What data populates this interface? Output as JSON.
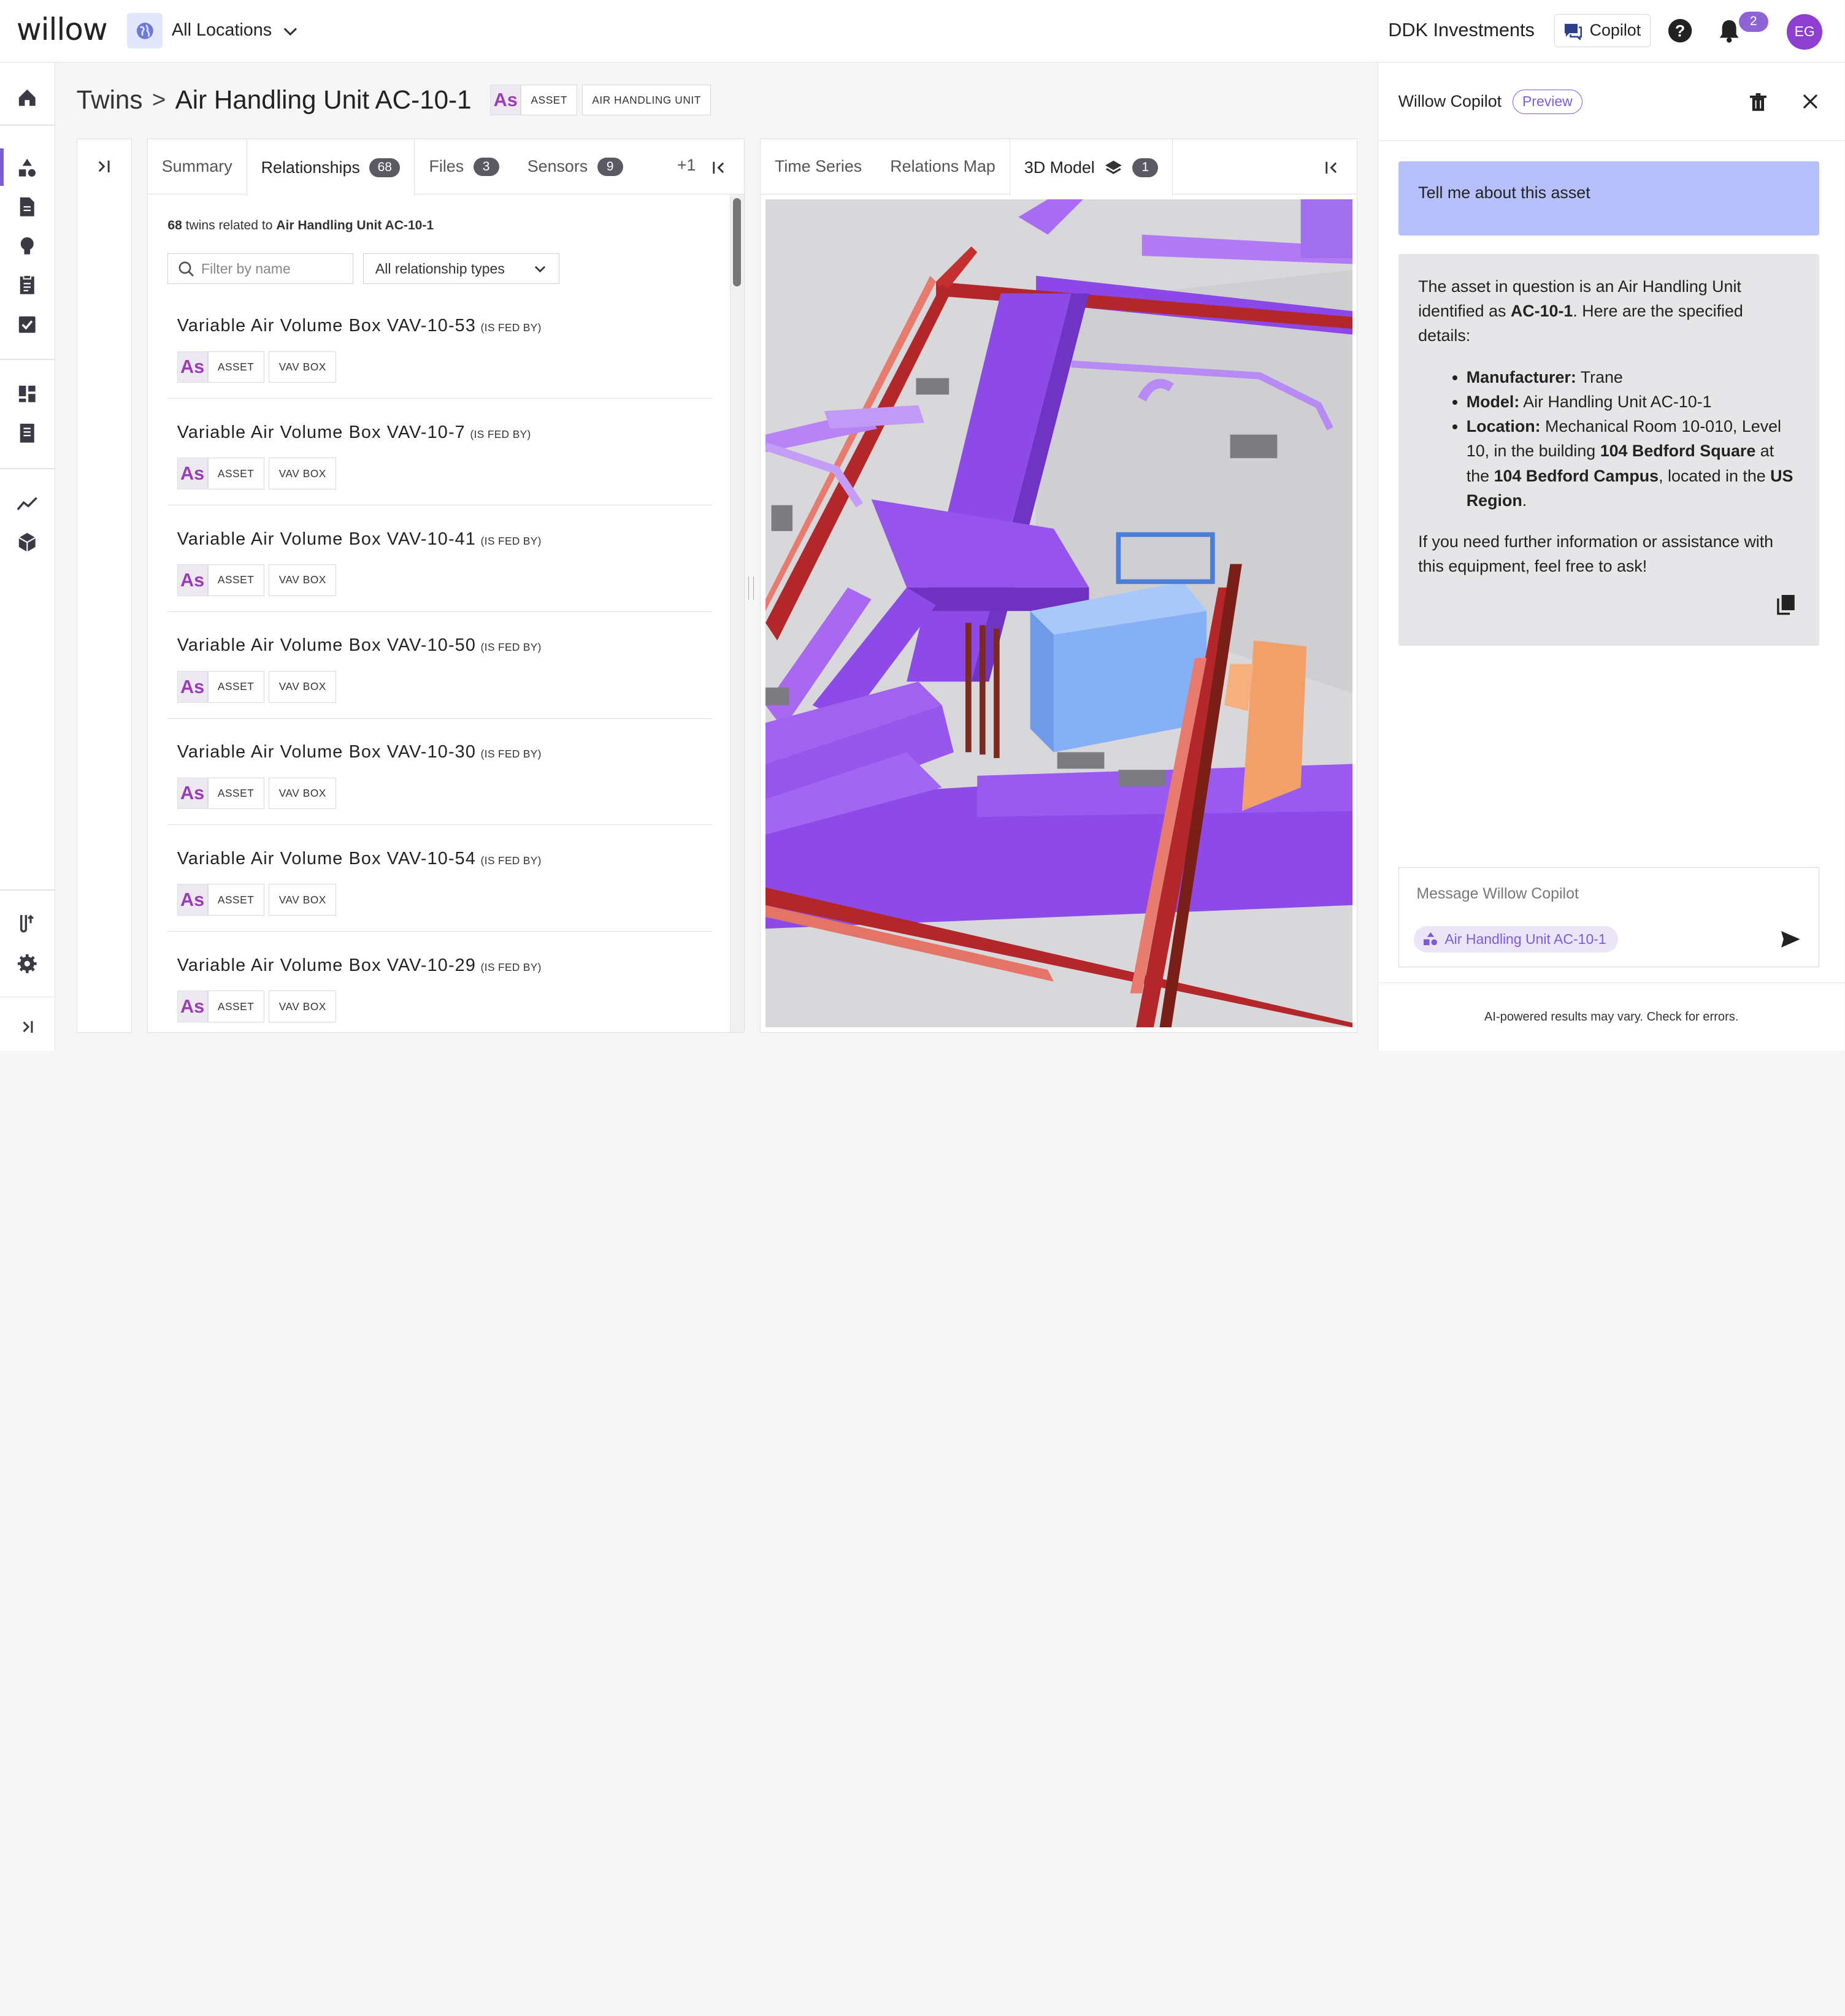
{
  "topbar": {
    "logo": "willow",
    "location": "All Locations",
    "org": "DDK Investments",
    "copilot_label": "Copilot",
    "notifications": "2",
    "avatar": "EG"
  },
  "breadcrumb": {
    "parent": "Twins",
    "sep": ">",
    "title": "Air Handling Unit AC-10-1",
    "chip_as": "As",
    "chip_type": "ASSET",
    "chip_model": "AIR HANDLING UNIT"
  },
  "left_tabs": {
    "tabs": [
      {
        "label": "Summary"
      },
      {
        "label": "Relationships",
        "badge": "68"
      },
      {
        "label": "Files",
        "badge": "3"
      },
      {
        "label": "Sensors",
        "badge": "9"
      }
    ],
    "more": "+1"
  },
  "relationships": {
    "count": "68",
    "count_text": " twins related to ",
    "subject": "Air Handling Unit AC-10-1",
    "filter_placeholder": "Filter by name",
    "type_select": "All relationship types",
    "items": [
      {
        "name": "Variable Air Volume Box VAV-10-53",
        "rel": "(IS FED BY)",
        "as": "As",
        "type": "ASSET",
        "model": "VAV BOX"
      },
      {
        "name": "Variable Air Volume Box VAV-10-7",
        "rel": "(IS FED BY)",
        "as": "As",
        "type": "ASSET",
        "model": "VAV BOX"
      },
      {
        "name": "Variable Air Volume Box VAV-10-41",
        "rel": "(IS FED BY)",
        "as": "As",
        "type": "ASSET",
        "model": "VAV BOX"
      },
      {
        "name": "Variable Air Volume Box VAV-10-50",
        "rel": "(IS FED BY)",
        "as": "As",
        "type": "ASSET",
        "model": "VAV BOX"
      },
      {
        "name": "Variable Air Volume Box VAV-10-30",
        "rel": "(IS FED BY)",
        "as": "As",
        "type": "ASSET",
        "model": "VAV BOX"
      },
      {
        "name": "Variable Air Volume Box VAV-10-54",
        "rel": "(IS FED BY)",
        "as": "As",
        "type": "ASSET",
        "model": "VAV BOX"
      },
      {
        "name": "Variable Air Volume Box VAV-10-29",
        "rel": "(IS FED BY)",
        "as": "As",
        "type": "ASSET",
        "model": "VAV BOX"
      }
    ]
  },
  "right_tabs": {
    "tabs": [
      {
        "label": "Time Series"
      },
      {
        "label": "Relations Map"
      },
      {
        "label": "3D Model",
        "badge": "1"
      }
    ]
  },
  "copilot": {
    "title": "Willow Copilot",
    "preview": "Preview",
    "user_message": "Tell me about this asset",
    "answer_intro_1": "The asset in question is an Air Handling Unit identified as ",
    "answer_intro_id": "AC-10-1",
    "answer_intro_2": ". Here are the specified details:",
    "details": {
      "manufacturer_label": "Manufacturer:",
      "manufacturer": " Trane",
      "model_label": "Model:",
      "model": " Air Handling Unit AC-10-1",
      "location_label": "Location:",
      "location_1": " Mechanical Room 10-010, Level 10, in the building ",
      "building": "104 Bedford Square",
      "location_2": " at the ",
      "campus": "104 Bedford Campus",
      "location_3": ", located in the ",
      "region": "US Region",
      "location_4": "."
    },
    "answer_outro": "If you need further information or assistance with this equipment, feel free to ask!",
    "input_placeholder": "Message Willow Copilot",
    "context_chip": "Air Handling Unit AC-10-1",
    "footer": "AI-powered results may vary. Check for errors."
  },
  "colors": {
    "accent": "#7a5cd6",
    "duct_purple": "#9b59f0",
    "pipe_red": "#b02a2a",
    "equipment_blue": "#8fb6f5",
    "equipment_orange": "#f4a468"
  }
}
